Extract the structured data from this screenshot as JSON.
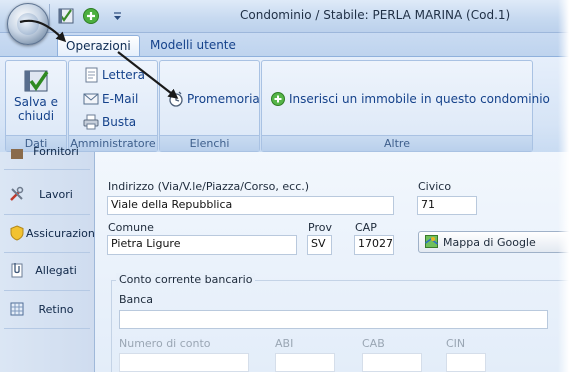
{
  "window": {
    "title": "Condominio / Stabile: PERLA MARINA (Cod.1)"
  },
  "quick_access": {
    "icons": [
      "save-icon",
      "add-icon",
      "customize-arrow-icon"
    ]
  },
  "tabs": [
    {
      "label": "Operazioni",
      "active": true
    },
    {
      "label": "Modelli utente",
      "active": false
    }
  ],
  "ribbon": {
    "groups": {
      "dati": {
        "label": "Dati",
        "save_line1": "Salva e",
        "save_line2": "chiudi"
      },
      "amministratore": {
        "label": "Amministratore",
        "lettera": "Lettera",
        "email": "E-Mail",
        "busta": "Busta"
      },
      "elenchi": {
        "label": "Elenchi",
        "promemoria": "Promemoria"
      },
      "altre": {
        "label": "Altre",
        "inserisci": "Inserisci un immobile in questo condominio"
      }
    }
  },
  "sidebar": {
    "items": [
      {
        "label": "Fornitori"
      },
      {
        "label": "Lavori"
      },
      {
        "label": "Assicurazioni"
      },
      {
        "label": "Allegati"
      },
      {
        "label": "Retino"
      }
    ]
  },
  "form": {
    "indirizzo_label": "Indirizzo (Via/V.le/Piazza/Corso, ecc.)",
    "indirizzo_value": "Viale della Repubblica",
    "civico_label": "Civico",
    "civico_value": "71",
    "comune_label": "Comune",
    "comune_value": "Pietra Ligure",
    "prov_label": "Prov",
    "prov_value": "SV",
    "cap_label": "CAP",
    "cap_value": "17027",
    "mappa_button": "Mappa di Google",
    "conto_legend": "Conto corrente bancario",
    "banca_label": "Banca",
    "banca_value": "",
    "numero_conto_label": "Numero di conto",
    "abi_label": "ABI",
    "cab_label": "CAB",
    "cin_label": "CIN"
  },
  "colors": {
    "ribbon_text": "#15428b",
    "arrow": "#1a1a1a"
  }
}
